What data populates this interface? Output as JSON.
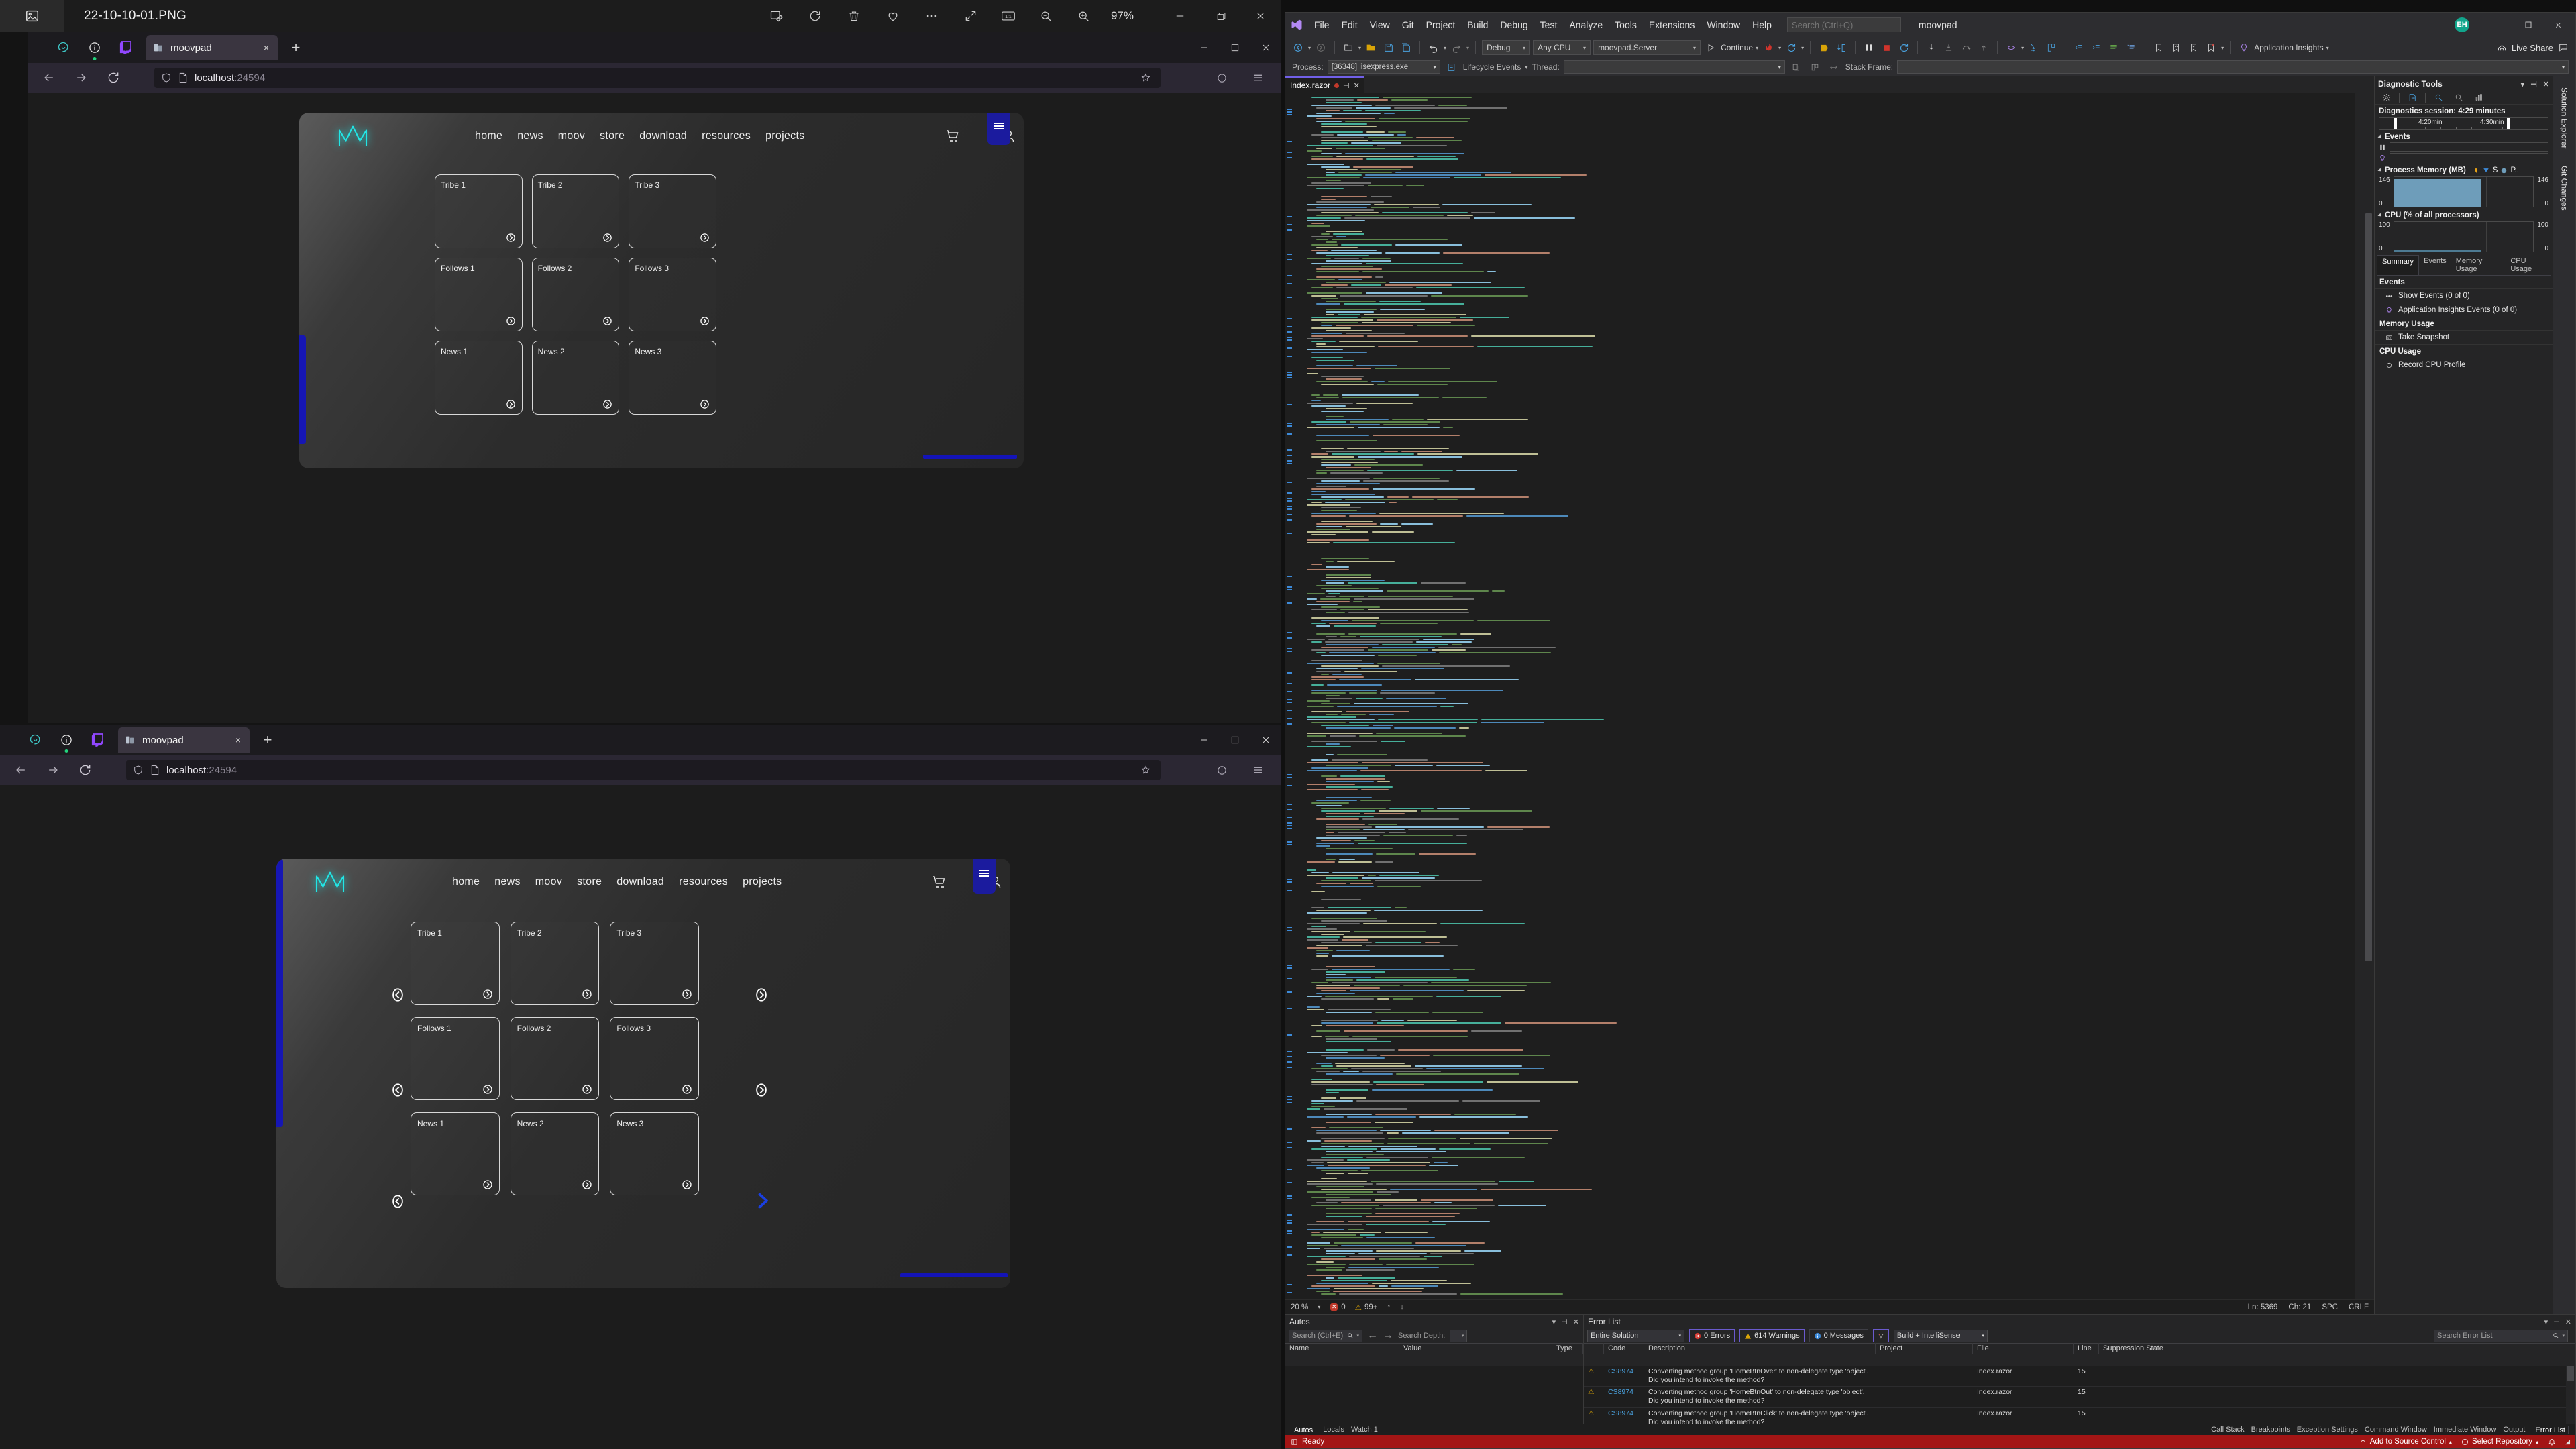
{
  "viewer": {
    "title": "22-10-10-01.PNG",
    "icon": "photo-icon",
    "tools": [
      "edit-image-icon",
      "rotate-icon",
      "delete-icon",
      "favorite-icon",
      "more-options-icon"
    ],
    "zoom_level": "97%",
    "window_controls": [
      "minimize",
      "restore",
      "close"
    ]
  },
  "browsers": [
    {
      "tab_title": "moovpad",
      "url_text": "localhost",
      "url_port": ":24594",
      "new_tab_label": "+",
      "close_label": "×"
    },
    {
      "tab_title": "moovpad",
      "url_text": "localhost",
      "url_port": ":24594",
      "new_tab_label": "+",
      "close_label": "×"
    }
  ],
  "webpage": {
    "brand": "moov-logo",
    "nav_links": [
      "home",
      "news",
      "moov",
      "store",
      "download",
      "resources",
      "projects"
    ],
    "nav_icons": [
      "cart-icon",
      "account-icon"
    ],
    "menu_button": "hamburger-menu",
    "cards": [
      [
        "Tribe 1",
        "Tribe 2",
        "Tribe 3"
      ],
      [
        "Follows 1",
        "Follows 2",
        "Follows 3"
      ],
      [
        "News 1",
        "News 2",
        "News 3"
      ]
    ],
    "card_arrow": "chevron-right-circle",
    "side_prev": "chevron-left-circle",
    "side_next": "chevron-right-circle",
    "accent_color": "#1616b4",
    "logo_color": "#22e6e6"
  },
  "vs": {
    "project_name": "moovpad",
    "menu": [
      "File",
      "Edit",
      "View",
      "Git",
      "Project",
      "Build",
      "Debug",
      "Test",
      "Analyze",
      "Tools",
      "Extensions",
      "Window",
      "Help"
    ],
    "search_placeholder": "Search (Ctrl+Q)",
    "avatar_initials": "EH",
    "live_share": "Live Share",
    "toolbar": {
      "config": "Debug",
      "platform": "Any CPU",
      "startup_project": "moovpad.Server",
      "continue_label": "Continue",
      "app_insights": "Application Insights"
    },
    "process_bar": {
      "process_label": "Process:",
      "process_value": "[36348] iisexpress.exe",
      "lifecycle_label": "Lifecycle Events",
      "thread_label": "Thread:",
      "stack_frame_label": "Stack Frame:"
    },
    "editor": {
      "tab_name": "Index.razor",
      "zoom": "20 %",
      "errors": "0",
      "warnings": "99+",
      "line": "Ln: 5369",
      "column": "Ch: 21",
      "spaces": "SPC",
      "line_endings": "CRLF"
    },
    "diagnostics": {
      "title": "Diagnostic Tools",
      "session": "Diagnostics session: 4:29 minutes",
      "timeline_labels": [
        "4:20min",
        "4:30min"
      ],
      "sections": {
        "events": "Events",
        "memory": "Process Memory (MB)",
        "cpu": "CPU (% of all processors)"
      },
      "memory_legend": [
        "S",
        "P.."
      ],
      "memory_axis": [
        "146",
        "0"
      ],
      "cpu_axis": [
        "100",
        "0"
      ],
      "tabs": [
        "Summary",
        "Events",
        "Memory Usage",
        "CPU Usage"
      ],
      "active_tab": "Summary",
      "summary": [
        {
          "header": "Events"
        },
        {
          "item": "Show Events (0 of 0)",
          "icon": "events-icon"
        },
        {
          "item": "Application Insights Events (0 of 0)",
          "icon": "lightbulb-icon"
        },
        {
          "header": "Memory Usage"
        },
        {
          "item": "Take Snapshot",
          "icon": "camera-icon"
        },
        {
          "header": "CPU Usage"
        },
        {
          "item": "Record CPU Profile",
          "icon": "record-icon"
        }
      ]
    },
    "right_dock_tabs": [
      "Solution Explorer",
      "Git Changes"
    ],
    "autos": {
      "title": "Autos",
      "search_placeholder": "Search (Ctrl+E)",
      "search_depth_label": "Search Depth:",
      "search_depth_value": "",
      "columns": [
        "Name",
        "Value",
        "Type"
      ],
      "rows": []
    },
    "error_list": {
      "title": "Error List",
      "scope": "Entire Solution",
      "errors_label": "0 Errors",
      "warnings_label": "614 Warnings",
      "messages_label": "0 Messages",
      "build_filter": "Build + IntelliSense",
      "search_placeholder": "Search Error List",
      "columns": [
        "",
        "Code",
        "Description",
        "Project",
        "File",
        "Line",
        "Suppression State"
      ],
      "rows": [
        {
          "severity": "warning",
          "code": "CS8974",
          "description": "Converting method group 'HomeBtnOver' to non-delegate type 'object'. Did you intend to invoke the method?",
          "project": "",
          "file": "Index.razor",
          "line": "15",
          "suppression": ""
        },
        {
          "severity": "warning",
          "code": "CS8974",
          "description": "Converting method group 'HomeBtnOut' to non-delegate type 'object'. Did you intend to invoke the method?",
          "project": "",
          "file": "Index.razor",
          "line": "15",
          "suppression": ""
        },
        {
          "severity": "warning",
          "code": "CS8974",
          "description": "Converting method group 'HomeBtnClick' to non-delegate type 'object'. Did you intend to invoke the method?",
          "project": "",
          "file": "Index.razor",
          "line": "15",
          "suppression": ""
        }
      ]
    },
    "bottom_tabs_left": [
      "Autos",
      "Locals",
      "Watch 1"
    ],
    "bottom_tabs_right": [
      "Call Stack",
      "Breakpoints",
      "Exception Settings",
      "Command Window",
      "Immediate Window",
      "Output",
      "Error List"
    ],
    "active_bottom_right_tab": "Error List",
    "status": {
      "text": "Ready",
      "source_control": "Add to Source Control",
      "repository": "Select Repository",
      "bar_color": "#a31515"
    }
  }
}
